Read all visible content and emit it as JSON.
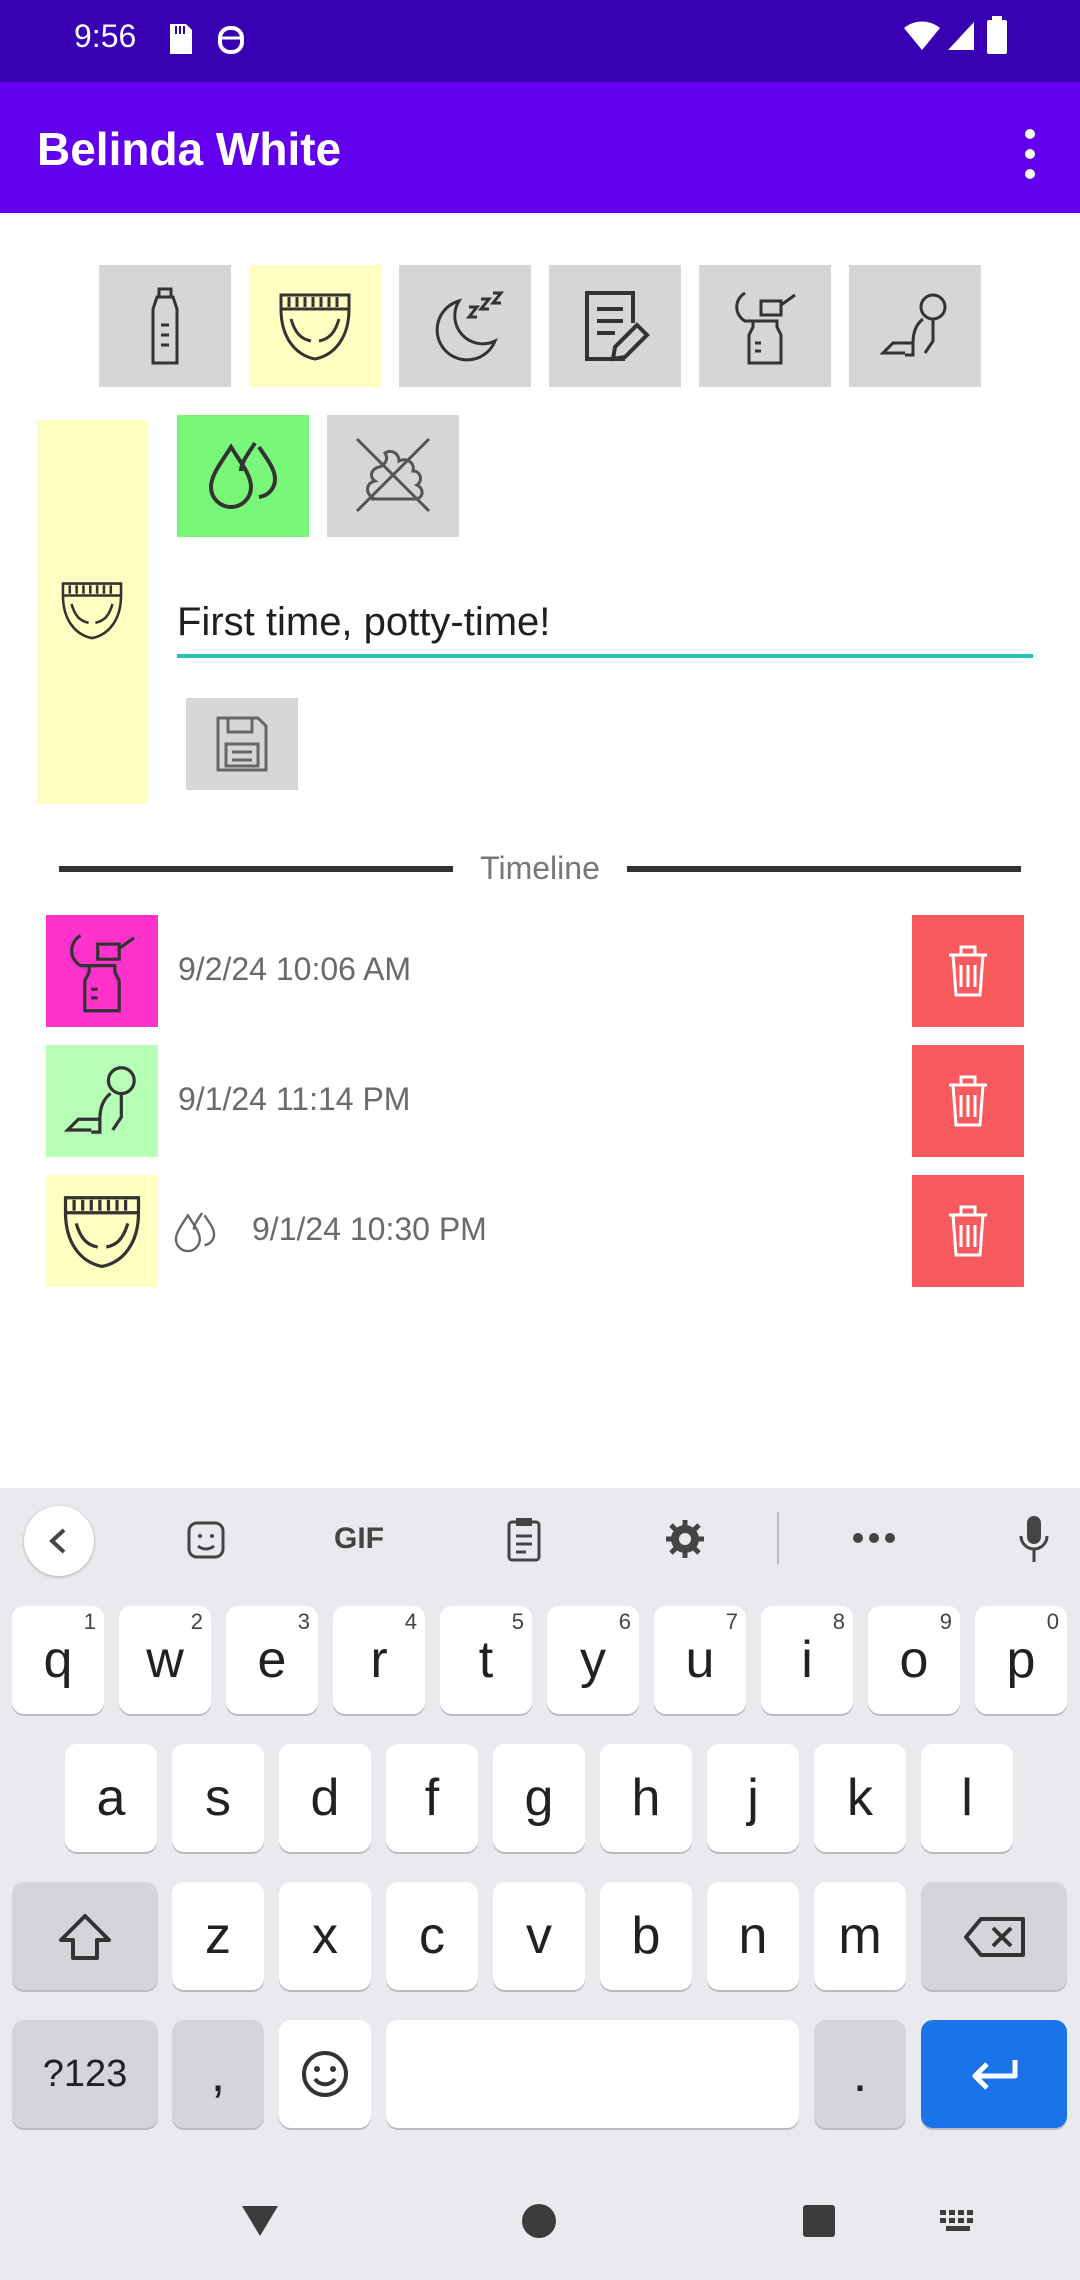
{
  "status_bar": {
    "time": "9:56"
  },
  "app_bar": {
    "title": "Belinda White"
  },
  "type_buttons": [
    "bottle-icon",
    "diaper-icon",
    "sleep-icon",
    "note-icon",
    "breast-pump-icon",
    "baby-crawl-icon"
  ],
  "diaper_options": [
    "wet-icon",
    "no-poop-icon"
  ],
  "note": {
    "value": "First time, potty-time!"
  },
  "timeline": {
    "label": "Timeline",
    "entries": [
      {
        "type": "pump",
        "datetime": "9/2/24  10:06 AM",
        "color": "#ff33cc"
      },
      {
        "type": "milestone",
        "datetime": "9/1/24  11:14 PM",
        "color": "#b7ffb7"
      },
      {
        "type": "diaper",
        "datetime": "9/1/24  10:30 PM",
        "color": "#ffffc2"
      }
    ]
  },
  "colors": {
    "status_bar": "#3700b3",
    "app_bar": "#6200ee",
    "selected": "#ffffc2",
    "wet_selected": "#78f778",
    "delete": "#f75a5e",
    "enter_key": "#1a73e8"
  },
  "keyboard": {
    "toolbar": [
      "back-icon",
      "sticker-icon",
      "GIF",
      "clipboard-icon",
      "gear-icon",
      "more-icon",
      "mic-icon"
    ],
    "row1": [
      [
        "q",
        "1"
      ],
      [
        "w",
        "2"
      ],
      [
        "e",
        "3"
      ],
      [
        "r",
        "4"
      ],
      [
        "t",
        "5"
      ],
      [
        "y",
        "6"
      ],
      [
        "u",
        "7"
      ],
      [
        "i",
        "8"
      ],
      [
        "o",
        "9"
      ],
      [
        "p",
        "0"
      ]
    ],
    "row2": [
      "a",
      "s",
      "d",
      "f",
      "g",
      "h",
      "j",
      "k",
      "l"
    ],
    "row3": [
      "z",
      "x",
      "c",
      "v",
      "b",
      "n",
      "m"
    ],
    "row4": {
      "sym": "?123",
      "comma": ",",
      "period": "."
    }
  }
}
